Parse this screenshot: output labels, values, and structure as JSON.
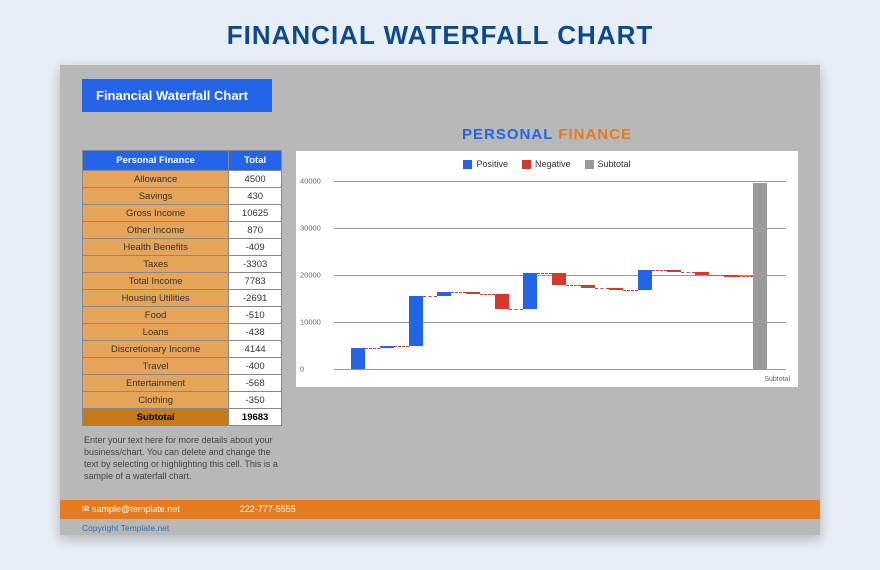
{
  "main_title": "FINANCIAL WATERFALL CHART",
  "badge": "Financial Waterfall Chart",
  "chart_title_personal": "PERSONAL",
  "chart_title_finance": "FINANCE",
  "table": {
    "header_label": "Personal Finance",
    "header_total": "Total",
    "rows": [
      {
        "label": "Allowance",
        "value": "4500"
      },
      {
        "label": "Savings",
        "value": "430"
      },
      {
        "label": "Gross Income",
        "value": "10625"
      },
      {
        "label": "Other Income",
        "value": "870"
      },
      {
        "label": "Health Benefits",
        "value": "-409"
      },
      {
        "label": "Taxes",
        "value": "-3303"
      },
      {
        "label": "Total Income",
        "value": "7783"
      },
      {
        "label": "Housing Utilities",
        "value": "-2691"
      },
      {
        "label": "Food",
        "value": "-510"
      },
      {
        "label": "Loans",
        "value": "-438"
      },
      {
        "label": "Discretionary Income",
        "value": "4144"
      },
      {
        "label": "Travel",
        "value": "-400"
      },
      {
        "label": "Entertainment",
        "value": "-568"
      },
      {
        "label": "Clothing",
        "value": "-350"
      }
    ],
    "subtotal_label": "Subtotal",
    "subtotal_value": "19683"
  },
  "legend": {
    "pos": "Positive",
    "neg": "Negative",
    "sub": "Subtotal"
  },
  "note": "Enter your text here for more details about your business/chart. You can delete and change the text by selecting or highlighting this cell. This is a sample of a waterfall chart.",
  "footer": {
    "email": "sample@template.net",
    "phone": "222-777-5555"
  },
  "copyright": "Copyright Template.net",
  "xlabel_subtotal": "Subtotal",
  "chart_data": {
    "type": "waterfall",
    "title": "PERSONAL FINANCE",
    "ylabel": "",
    "xlabel": "",
    "ylim": [
      0,
      40000
    ],
    "yticks": [
      0,
      10000,
      20000,
      30000,
      40000
    ],
    "series_legend": [
      "Positive",
      "Negative",
      "Subtotal"
    ],
    "categories": [
      "Allowance",
      "Savings",
      "Gross Income",
      "Other Income",
      "Health Benefits",
      "Taxes",
      "Total Income",
      "Housing Utilities",
      "Food",
      "Loans",
      "Discretionary Income",
      "Travel",
      "Entertainment",
      "Clothing",
      "Subtotal"
    ],
    "values": [
      4500,
      430,
      10625,
      870,
      -409,
      -3303,
      7783,
      -2691,
      -510,
      -438,
      4144,
      -400,
      -568,
      -350,
      19683
    ],
    "kind": [
      "pos",
      "pos",
      "pos",
      "pos",
      "neg",
      "neg",
      "pos",
      "neg",
      "neg",
      "neg",
      "pos",
      "neg",
      "neg",
      "neg",
      "sub"
    ],
    "subtotal_value_full": 39683
  }
}
